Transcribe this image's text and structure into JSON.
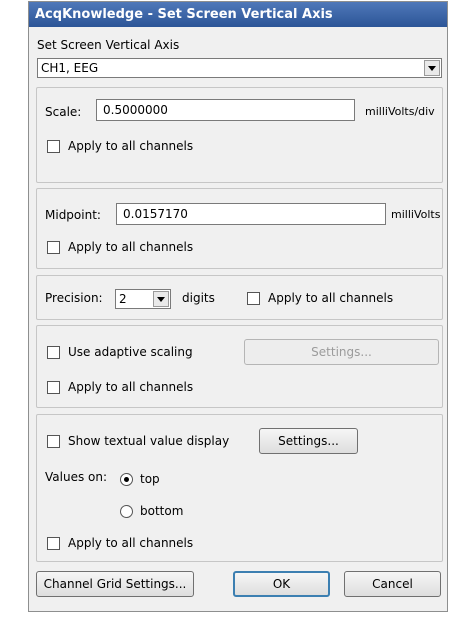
{
  "window": {
    "title": "AcqKnowledge - Set Screen Vertical Axis"
  },
  "header": {
    "label": "Set Screen Vertical Axis",
    "channel_selected": "CH1, EEG"
  },
  "scale": {
    "label": "Scale:",
    "value": "0.5000000",
    "unit": "milliVolts/div",
    "apply_label": "Apply to all channels"
  },
  "midpoint": {
    "label": "Midpoint:",
    "value": "0.0157170",
    "unit": "milliVolts",
    "apply_label": "Apply to all channels"
  },
  "precision": {
    "label": "Precision:",
    "value": "2",
    "unit": "digits",
    "apply_label": "Apply to all channels"
  },
  "adaptive": {
    "label": "Use adaptive scaling",
    "settings_label": "Settings...",
    "apply_label": "Apply to all channels"
  },
  "textual": {
    "label": "Show textual value display",
    "settings_label": "Settings...",
    "values_on_label": "Values on:",
    "top_label": "top",
    "bottom_label": "bottom",
    "apply_label": "Apply to all channels"
  },
  "footer": {
    "grid_settings_label": "Channel Grid Settings...",
    "ok_label": "OK",
    "cancel_label": "Cancel"
  }
}
